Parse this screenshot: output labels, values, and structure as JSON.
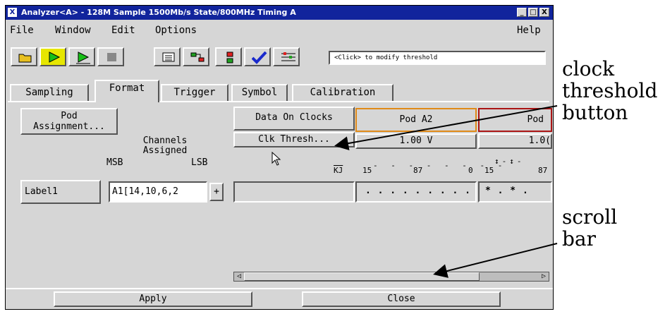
{
  "window": {
    "title": "Analyzer<A> - 128M Sample 1500Mb/s State/800MHz Timing A",
    "controls": [
      "_",
      "□",
      "X"
    ]
  },
  "menu": {
    "file": "File",
    "window": "Window",
    "edit": "Edit",
    "options": "Options",
    "help": "Help"
  },
  "toolbar": {
    "threshold_message": "<Click> to modify threshold"
  },
  "tabs": [
    "Sampling",
    "Format",
    "Trigger",
    "Symbol",
    "Calibration"
  ],
  "format": {
    "pod_assignment": "Pod\nAssignment...",
    "channels_assigned": "Channels\nAssigned",
    "msb": "MSB",
    "lsb": "LSB",
    "data_on_clocks": "Data On Clocks",
    "clk_thresh": "Clk Thresh...",
    "pod_a2": "Pod A2",
    "pod_next": "Pod",
    "threshold_a2": "1.00 V",
    "threshold_next": "1.0(",
    "axis_a2": {
      "kj": "KJ",
      "hi": "15",
      "mid": "87",
      "lo": "0"
    },
    "axis_next": {
      "hi": "15",
      "mid": "87"
    },
    "label_name": "Label1",
    "label_channels": "A1[14,10,6,2",
    "add_button": "+",
    "a2_channels": ". . . . . . . . .",
    "next_channels": "* . * ."
  },
  "buttons": {
    "apply": "Apply",
    "close": "Close"
  },
  "annotations": {
    "clock_threshold": "clock\nthreshold\nbutton",
    "scroll_bar": "scroll\nbar"
  }
}
